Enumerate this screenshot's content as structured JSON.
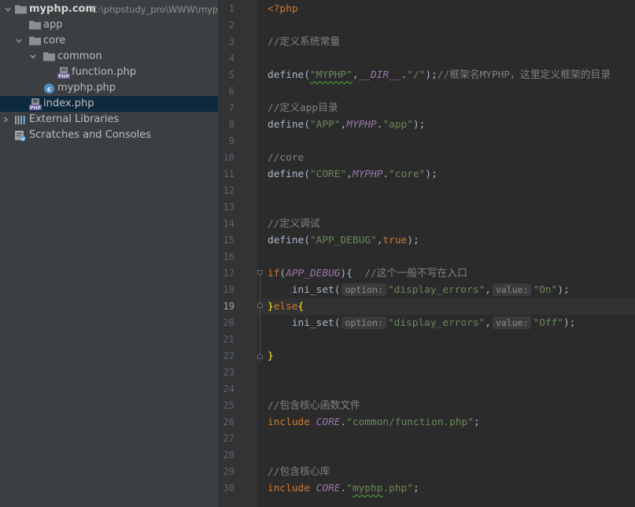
{
  "project_tree": {
    "rows": [
      {
        "label": "myphp.com",
        "path": "C:\\phpstudy_pro\\WWW\\myphp.com"
      },
      {
        "label": "app"
      },
      {
        "label": "core"
      },
      {
        "label": "common"
      },
      {
        "label": "function.php"
      },
      {
        "label": "myphp.php"
      },
      {
        "label": "index.php"
      },
      {
        "label": "External Libraries"
      },
      {
        "label": "Scratches and Consoles"
      }
    ],
    "colors": {
      "folder": "#8a8f94",
      "selected": "#0d293e",
      "php_badge": "#6b5aa6",
      "class_badge": "#4f8ec5"
    }
  },
  "editor": {
    "current_line": 19,
    "line_numbers": [
      "1",
      "2",
      "3",
      "4",
      "5",
      "6",
      "7",
      "8",
      "9",
      "10",
      "11",
      "12",
      "13",
      "14",
      "15",
      "16",
      "17",
      "18",
      "19",
      "20",
      "21",
      "22",
      "23",
      "24",
      "25",
      "26",
      "27",
      "28",
      "29",
      "30"
    ],
    "lines": {
      "l1": {
        "open_tag": "<?php"
      },
      "l3": {
        "comment": "//定义系统常量"
      },
      "l5": {
        "fn": "define(",
        "s1": "\"MYPHP\"",
        "sep": ",",
        "dir": "__DIR__",
        "dot": ".",
        "s2": "\"/\"",
        "end": ");",
        "comment": "//框架名MYPHP，这里定义框架的目录"
      },
      "l7": {
        "comment": "//定义app目录"
      },
      "l8": {
        "fn": "define(",
        "s1": "\"APP\"",
        "sep": ",",
        "cst": "MYPHP",
        "dot": ".",
        "s2": "\"app\"",
        "end": ");"
      },
      "l10": {
        "comment": "//core"
      },
      "l11": {
        "fn": "define(",
        "s1": "\"CORE\"",
        "sep": ",",
        "cst": "MYPHP",
        "dot": ".",
        "s2": "\"core\"",
        "end": ");"
      },
      "l14": {
        "comment": "//定义调试"
      },
      "l15": {
        "fn": "define(",
        "s1": "\"APP_DEBUG\"",
        "sep": ",",
        "kw": "true",
        "end": ");"
      },
      "l17": {
        "kw": "if",
        "open": "(",
        "cst": "APP_DEBUG",
        "close": "){",
        "gap": "  ",
        "comment": "//这个一般不写在入口"
      },
      "l18": {
        "indent": "    ",
        "fn": "ini_set(",
        "hint1": "option:",
        "s1": "\"display_errors\"",
        "sep": ",",
        "hint2": "value:",
        "s2": "\"On\"",
        "end": ");"
      },
      "l19": {
        "brace1": "}",
        "kw": "else",
        "brace2": "{"
      },
      "l20": {
        "indent": "    ",
        "fn": "ini_set(",
        "hint1": "option:",
        "s1": "\"display_errors\"",
        "sep": ",",
        "hint2": "value:",
        "s2": "\"Off\"",
        "end": ");"
      },
      "l22": {
        "brace": "}"
      },
      "l25": {
        "comment": "//包含核心函数文件"
      },
      "l26": {
        "kw": "include",
        "sp": " ",
        "cst": "CORE",
        "dot": ".",
        "s1": "\"common/function.php\"",
        "end": ";"
      },
      "l29": {
        "comment": "//包含核心库"
      },
      "l30": {
        "kw": "include",
        "sp": " ",
        "cst": "CORE",
        "dot": ".",
        "q1": "\"",
        "s1": "myphp",
        "s2": ".php\"",
        "end": ";"
      }
    },
    "colors": {
      "background": "#2b2b2b",
      "gutter": "#313335",
      "keyword": "#cc7832",
      "string": "#6a8759",
      "comment": "#808080",
      "constant": "#9876aa",
      "text": "#a9b7c6",
      "matched_brace": "#ffef28"
    }
  }
}
